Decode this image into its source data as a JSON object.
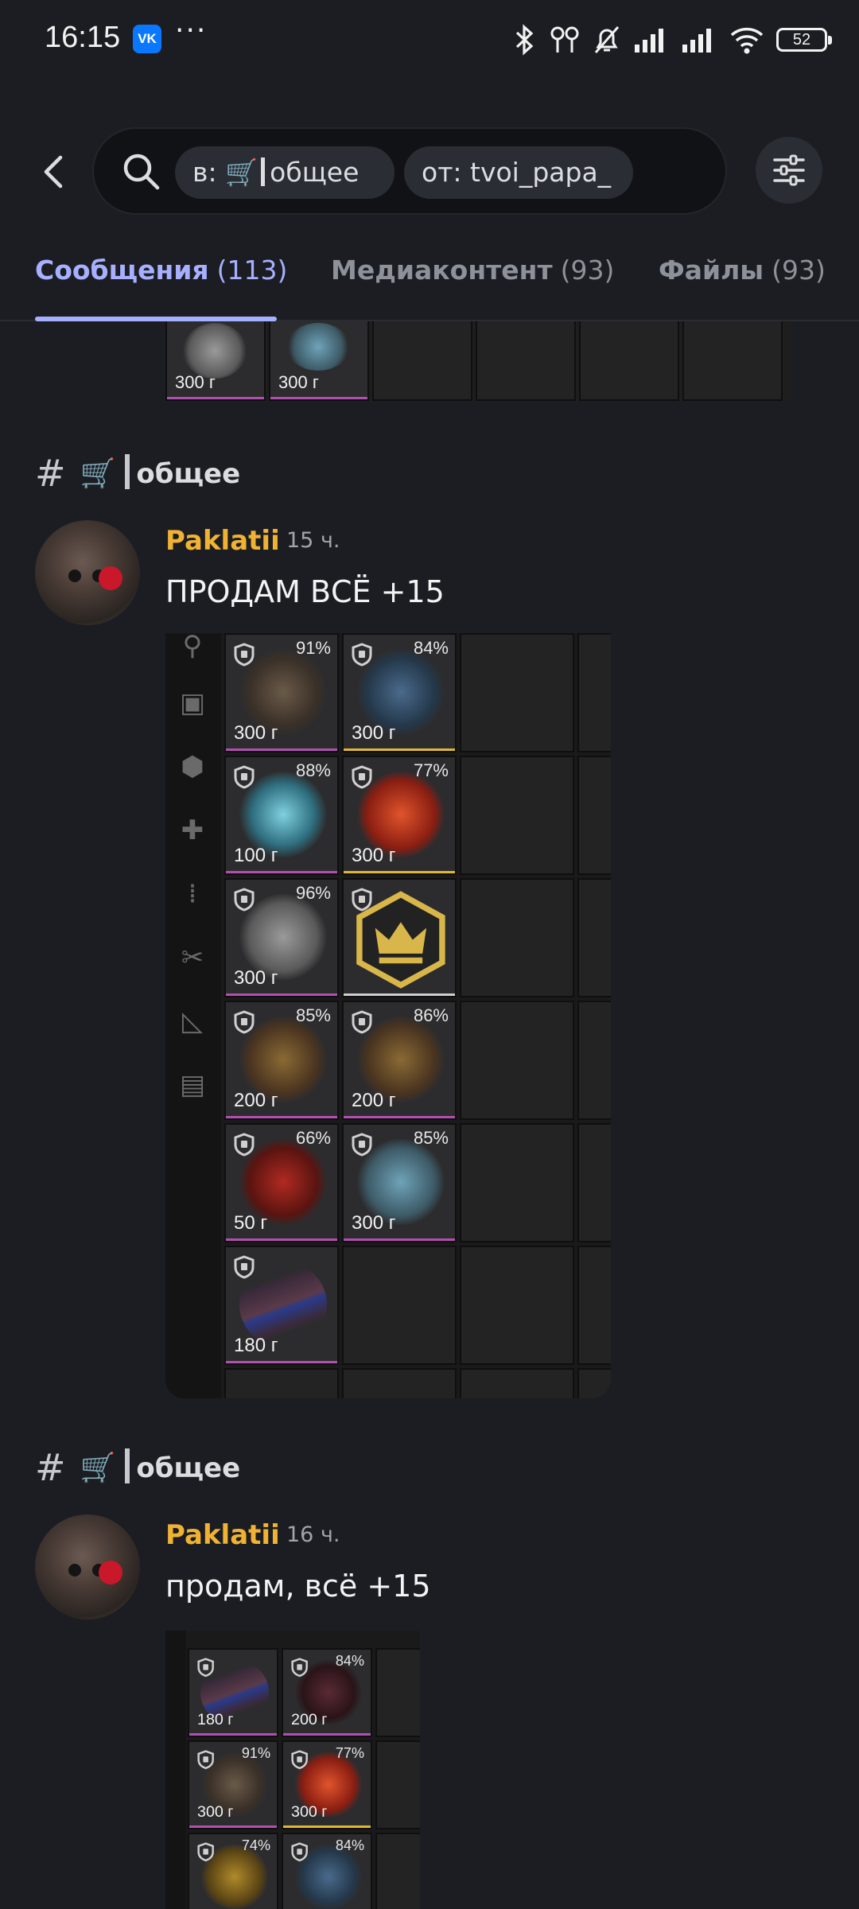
{
  "status_bar": {
    "time": "16:15",
    "app_badge": "VK",
    "more": "···",
    "battery": "52"
  },
  "search": {
    "channel_chip_prefix": "в:",
    "channel_chip_icon": "🛒",
    "channel_chip_name": "общее",
    "from_chip": "от: tvoi_papa_"
  },
  "tabs": [
    {
      "label": "Сообщения",
      "count": "(113)"
    },
    {
      "label": "Медиаконтент",
      "count": "(93)"
    },
    {
      "label": "Файлы",
      "count": "(93)"
    }
  ],
  "top_partial": {
    "items": [
      {
        "price": "300 г"
      },
      {
        "price": "300 г"
      }
    ]
  },
  "messages": [
    {
      "channel": {
        "hash": "#",
        "icon": "🛒",
        "name": "общее"
      },
      "author": "Paklatii",
      "time": "15 ч.",
      "text": "ПРОДАМ ВСЁ +15",
      "items": [
        {
          "pct": "91%",
          "price": "300 г"
        },
        {
          "pct": "84%",
          "price": "300 г"
        },
        {
          "pct": "88%",
          "price": "100 г"
        },
        {
          "pct": "77%",
          "price": "300 г"
        },
        {
          "pct": "96%",
          "price": "300 г"
        },
        {
          "pct": "",
          "price": ""
        },
        {
          "pct": "85%",
          "price": "200 г"
        },
        {
          "pct": "86%",
          "price": "200 г"
        },
        {
          "pct": "66%",
          "price": "50 г"
        },
        {
          "pct": "85%",
          "price": "300 г"
        },
        {
          "pct": "",
          "price": "180 г"
        }
      ]
    },
    {
      "channel": {
        "hash": "#",
        "icon": "🛒",
        "name": "общее"
      },
      "author": "Paklatii",
      "time": "16 ч.",
      "text": "продам, всё +15",
      "items": [
        {
          "pct": "",
          "price": "180 г"
        },
        {
          "pct": "84%",
          "price": "200 г"
        },
        {
          "pct": "91%",
          "price": "300 г"
        },
        {
          "pct": "77%",
          "price": "300 г"
        },
        {
          "pct": "74%",
          "price": ""
        },
        {
          "pct": "84%",
          "price": ""
        }
      ]
    }
  ],
  "colors": {
    "accent": "#a7b0ff",
    "author": "#f0b232",
    "background": "#1c1d22"
  }
}
